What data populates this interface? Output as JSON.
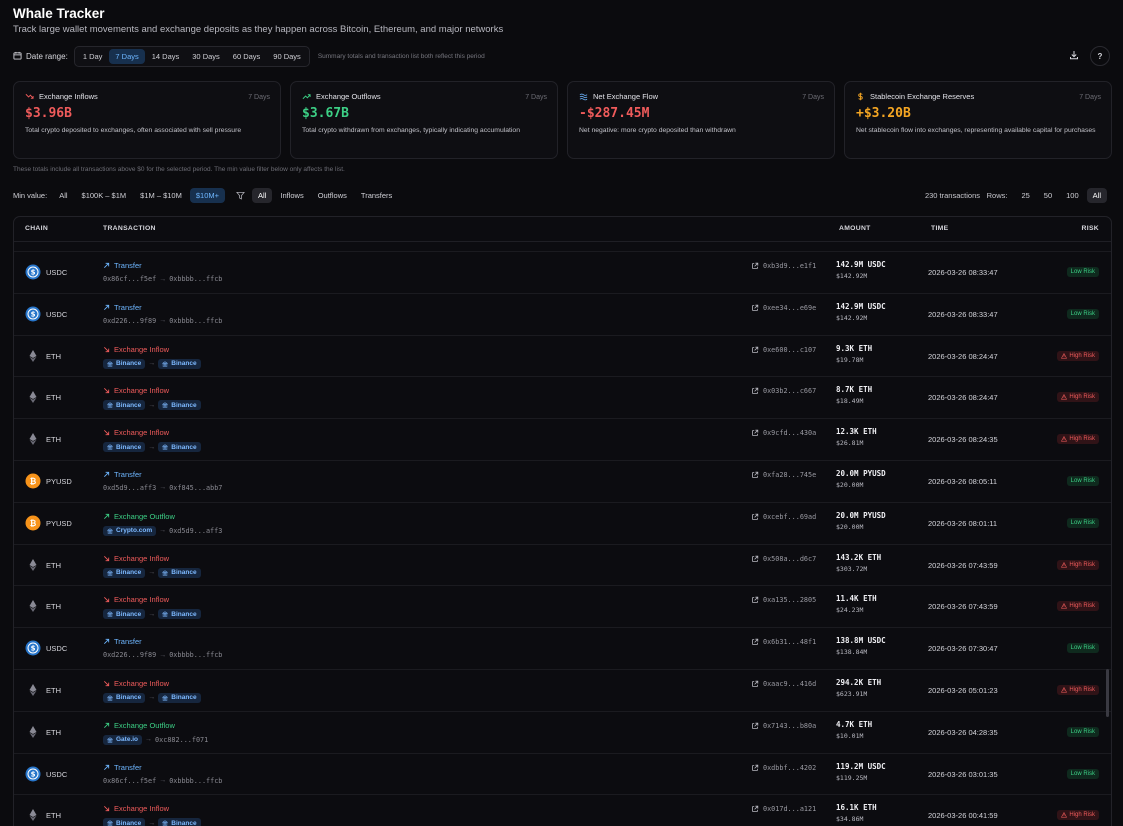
{
  "header": {
    "title": "Whale Tracker",
    "subtitle": "Track large wallet movements and exchange deposits as they happen across Bitcoin, Ethereum, and major networks"
  },
  "range": {
    "label": "Date range:",
    "options": [
      "1 Day",
      "7 Days",
      "14 Days",
      "30 Days",
      "60 Days",
      "90 Days"
    ],
    "selected": "7 Days",
    "note": "Summary totals and transaction list both reflect this period"
  },
  "help_label": "?",
  "cards": [
    {
      "title": "Exchange Inflows",
      "period": "7 Days",
      "value": "$3.96B",
      "color": "#ef5b5b",
      "icon": "trend-down-icon",
      "desc": "Total crypto deposited to exchanges, often associated with sell pressure"
    },
    {
      "title": "Exchange Outflows",
      "period": "7 Days",
      "value": "$3.67B",
      "color": "#3ccf85",
      "icon": "trend-up-icon",
      "desc": "Total crypto withdrawn from exchanges, typically indicating accumulation"
    },
    {
      "title": "Net Exchange Flow",
      "period": "7 Days",
      "value": "-$287.45M",
      "color": "#ef5b5b",
      "icon": "flow-icon",
      "desc": "Net negative: more crypto deposited than withdrawn"
    },
    {
      "title": "Stablecoin Exchange Reserves",
      "period": "7 Days",
      "value": "+$3.20B",
      "color": "#f5a623",
      "icon": "dollar-icon",
      "desc": "Net stablecoin flow into exchanges, representing available capital for purchases"
    }
  ],
  "totals_note": "These totals include all transactions above $0 for the selected period. The min value filter below only affects the list.",
  "filters": {
    "min_label": "Min value:",
    "min_options": [
      "All",
      "$100K – $1M",
      "$1M – $10M",
      "$10M+"
    ],
    "min_selected": "$10M+",
    "type_options": [
      "All",
      "Inflows",
      "Outflows",
      "Transfers"
    ],
    "type_selected": "All",
    "tx_count": "230 transactions",
    "rows_label": "Rows:",
    "rows_options": [
      "25",
      "50",
      "100",
      "All"
    ],
    "rows_selected": "All"
  },
  "table": {
    "headers": {
      "chain": "CHAIN",
      "transaction": "TRANSACTION",
      "amount": "AMOUNT",
      "time": "TIME",
      "risk": "RISK"
    },
    "rows": [
      {
        "chain": "USDC",
        "chain_icon": "usdc",
        "type": "Transfer",
        "kind": "transfer",
        "from": "0x86cf...f5ef",
        "to": "0xbbbb...ffcb",
        "from_ex": false,
        "to_ex": false,
        "hash": "0xb3d9...e1f1",
        "amount": "142.9M USDC",
        "usd": "$142.92M",
        "time": "2026-03-26 08:33:47",
        "risk": "Low Risk",
        "risk_level": "low"
      },
      {
        "chain": "USDC",
        "chain_icon": "usdc",
        "type": "Transfer",
        "kind": "transfer",
        "from": "0xd226...9f89",
        "to": "0xbbbb...ffcb",
        "from_ex": false,
        "to_ex": false,
        "hash": "0xee34...e69e",
        "amount": "142.9M USDC",
        "usd": "$142.92M",
        "time": "2026-03-26 08:33:47",
        "risk": "Low Risk",
        "risk_level": "low"
      },
      {
        "chain": "ETH",
        "chain_icon": "eth",
        "type": "Exchange Inflow",
        "kind": "inflow",
        "from": "Binance",
        "to": "Binance",
        "from_ex": true,
        "to_ex": true,
        "hash": "0xe600...c107",
        "amount": "9.3K ETH",
        "usd": "$19.78M",
        "time": "2026-03-26 08:24:47",
        "risk": "High Risk",
        "risk_level": "high"
      },
      {
        "chain": "ETH",
        "chain_icon": "eth",
        "type": "Exchange Inflow",
        "kind": "inflow",
        "from": "Binance",
        "to": "Binance",
        "from_ex": true,
        "to_ex": true,
        "hash": "0x03b2...c667",
        "amount": "8.7K ETH",
        "usd": "$18.49M",
        "time": "2026-03-26 08:24:47",
        "risk": "High Risk",
        "risk_level": "high"
      },
      {
        "chain": "ETH",
        "chain_icon": "eth",
        "type": "Exchange Inflow",
        "kind": "inflow",
        "from": "Binance",
        "to": "Binance",
        "from_ex": true,
        "to_ex": true,
        "hash": "0x9cfd...430a",
        "amount": "12.3K ETH",
        "usd": "$26.81M",
        "time": "2026-03-26 08:24:35",
        "risk": "High Risk",
        "risk_level": "high"
      },
      {
        "chain": "PYUSD",
        "chain_icon": "pyusd",
        "type": "Transfer",
        "kind": "transfer",
        "from": "0xd5d9...aff3",
        "to": "0xf845...abb7",
        "from_ex": false,
        "to_ex": false,
        "hash": "0xfa28...745e",
        "amount": "20.0M PYUSD",
        "usd": "$20.00M",
        "time": "2026-03-26 08:05:11",
        "risk": "Low Risk",
        "risk_level": "low"
      },
      {
        "chain": "PYUSD",
        "chain_icon": "pyusd",
        "type": "Exchange Outflow",
        "kind": "outflow",
        "from": "Crypto.com",
        "to": "0xd5d9...aff3",
        "from_ex": true,
        "to_ex": false,
        "hash": "0xcebf...69ad",
        "amount": "20.0M PYUSD",
        "usd": "$20.00M",
        "time": "2026-03-26 08:01:11",
        "risk": "Low Risk",
        "risk_level": "low"
      },
      {
        "chain": "ETH",
        "chain_icon": "eth",
        "type": "Exchange Inflow",
        "kind": "inflow",
        "from": "Binance",
        "to": "Binance",
        "from_ex": true,
        "to_ex": true,
        "hash": "0x508a...d6c7",
        "amount": "143.2K ETH",
        "usd": "$303.72M",
        "time": "2026-03-26 07:43:59",
        "risk": "High Risk",
        "risk_level": "high"
      },
      {
        "chain": "ETH",
        "chain_icon": "eth",
        "type": "Exchange Inflow",
        "kind": "inflow",
        "from": "Binance",
        "to": "Binance",
        "from_ex": true,
        "to_ex": true,
        "hash": "0xa135...2805",
        "amount": "11.4K ETH",
        "usd": "$24.23M",
        "time": "2026-03-26 07:43:59",
        "risk": "High Risk",
        "risk_level": "high"
      },
      {
        "chain": "USDC",
        "chain_icon": "usdc",
        "type": "Transfer",
        "kind": "transfer",
        "from": "0xd226...9f89",
        "to": "0xbbbb...ffcb",
        "from_ex": false,
        "to_ex": false,
        "hash": "0x6b31...48f1",
        "amount": "138.8M USDC",
        "usd": "$138.84M",
        "time": "2026-03-26 07:30:47",
        "risk": "Low Risk",
        "risk_level": "low"
      },
      {
        "chain": "ETH",
        "chain_icon": "eth",
        "type": "Exchange Inflow",
        "kind": "inflow",
        "from": "Binance",
        "to": "Binance",
        "from_ex": true,
        "to_ex": true,
        "hash": "0xaac9...416d",
        "amount": "294.2K ETH",
        "usd": "$623.91M",
        "time": "2026-03-26 05:01:23",
        "risk": "High Risk",
        "risk_level": "high"
      },
      {
        "chain": "ETH",
        "chain_icon": "eth",
        "type": "Exchange Outflow",
        "kind": "outflow",
        "from": "Gate.io",
        "to": "0xc882...f071",
        "from_ex": true,
        "to_ex": false,
        "hash": "0x7143...b80a",
        "amount": "4.7K ETH",
        "usd": "$10.01M",
        "time": "2026-03-26 04:28:35",
        "risk": "Low Risk",
        "risk_level": "low"
      },
      {
        "chain": "USDC",
        "chain_icon": "usdc",
        "type": "Transfer",
        "kind": "transfer",
        "from": "0x86cf...f5ef",
        "to": "0xbbbb...ffcb",
        "from_ex": false,
        "to_ex": false,
        "hash": "0xdbbf...4202",
        "amount": "119.2M USDC",
        "usd": "$119.25M",
        "time": "2026-03-26 03:01:35",
        "risk": "Low Risk",
        "risk_level": "low"
      },
      {
        "chain": "ETH",
        "chain_icon": "eth",
        "type": "Exchange Inflow",
        "kind": "inflow",
        "from": "Binance",
        "to": "Binance",
        "from_ex": true,
        "to_ex": true,
        "hash": "0x017d...a121",
        "amount": "16.1K ETH",
        "usd": "$34.86M",
        "time": "2026-03-26 00:41:59",
        "risk": "High Risk",
        "risk_level": "high"
      }
    ]
  }
}
